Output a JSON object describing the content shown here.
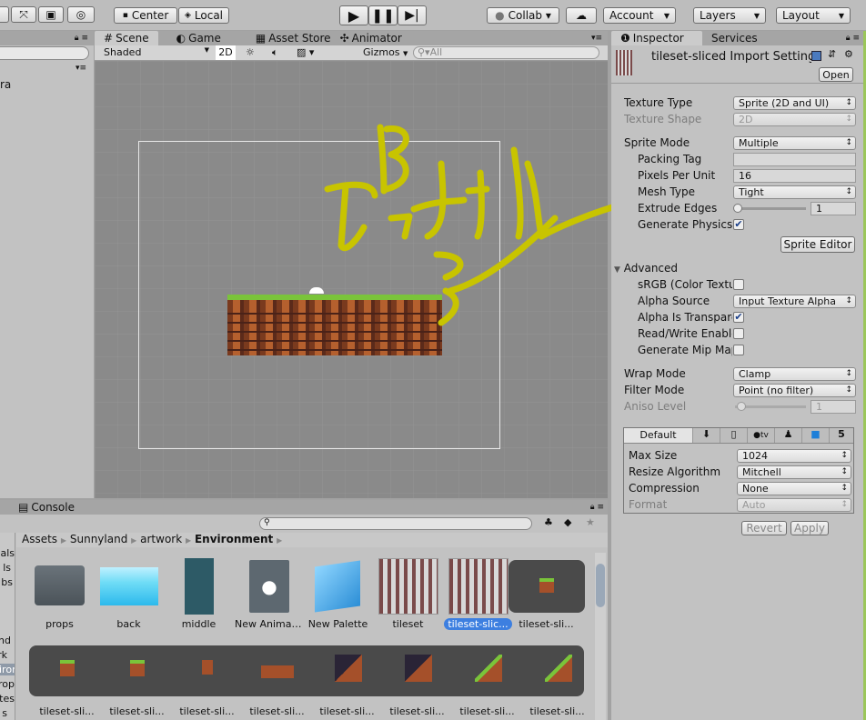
{
  "toolbar": {
    "pivot": "Center",
    "space": "Local",
    "collab": "Collab ▾",
    "account": "Account",
    "layers": "Layers",
    "layout": "Layout"
  },
  "hierarchy": {
    "partial_item": "ra"
  },
  "scene": {
    "tabs": [
      "Scene",
      "Game",
      "Asset Store",
      "Animator"
    ],
    "shading": "Shaded",
    "mode2d": "2D",
    "gizmos": "Gizmos",
    "search_placeholder": "All"
  },
  "inspector": {
    "tabs": [
      "Inspector",
      "Services"
    ],
    "title": "tileset-sliced Import Settings",
    "open": "Open",
    "texture_type": {
      "label": "Texture Type",
      "value": "Sprite (2D and UI)"
    },
    "texture_shape": {
      "label": "Texture Shape",
      "value": "2D"
    },
    "sprite_mode": {
      "label": "Sprite Mode",
      "value": "Multiple"
    },
    "packing_tag": {
      "label": "Packing Tag",
      "value": ""
    },
    "pixels_per_unit": {
      "label": "Pixels Per Unit",
      "value": "16"
    },
    "mesh_type": {
      "label": "Mesh Type",
      "value": "Tight"
    },
    "extrude_edges": {
      "label": "Extrude Edges",
      "value": "1"
    },
    "generate_physics": {
      "label": "Generate Physics",
      "checked": true
    },
    "sprite_editor": "Sprite Editor",
    "advanced": "Advanced",
    "srgb": {
      "label": "sRGB (Color Texture)",
      "checked": false
    },
    "alpha_source": {
      "label": "Alpha Source",
      "value": "Input Texture Alpha"
    },
    "alpha_transparency": {
      "label": "Alpha Is Transparency",
      "checked": true
    },
    "read_write": {
      "label": "Read/Write Enabled",
      "checked": false
    },
    "mip_maps": {
      "label": "Generate Mip Maps",
      "checked": false
    },
    "wrap_mode": {
      "label": "Wrap Mode",
      "value": "Clamp"
    },
    "filter_mode": {
      "label": "Filter Mode",
      "value": "Point (no filter)"
    },
    "aniso_level": {
      "label": "Aniso Level",
      "value": "1"
    },
    "platform_default": "Default",
    "max_size": {
      "label": "Max Size",
      "value": "1024"
    },
    "resize": {
      "label": "Resize Algorithm",
      "value": "Mitchell"
    },
    "compression": {
      "label": "Compression",
      "value": "None"
    },
    "format": {
      "label": "Format",
      "value": "Auto"
    },
    "revert": "Revert",
    "apply": "Apply"
  },
  "console": {
    "tab": "Console"
  },
  "project": {
    "breadcrumb": [
      "Assets",
      "Sunnyland",
      "artwork",
      "Environment"
    ],
    "tree_partial": [
      "rials",
      "ls",
      "bs",
      "nd",
      "rk",
      "iron",
      "rop",
      "ites",
      "s"
    ],
    "assets_row1": [
      "props",
      "back",
      "middle",
      "New Animat...",
      "New Palette",
      "tileset",
      "tileset-slic...",
      "tileset-sli..."
    ],
    "assets_row2": [
      "tileset-sli...",
      "tileset-sli...",
      "tileset-sli...",
      "tileset-sli...",
      "tileset-sli...",
      "tileset-sli...",
      "tileset-sli...",
      "tileset-sli..."
    ]
  },
  "colors": {
    "annotation": "#c8c400",
    "selection": "#3d7fe0",
    "scene_bg": "#8a8a8a"
  }
}
